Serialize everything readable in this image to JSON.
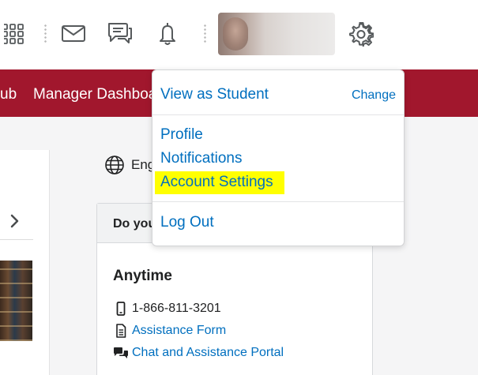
{
  "header": {
    "icons": [
      "apps-grid-icon",
      "mail-icon",
      "chat-icon",
      "bell-icon",
      "gear-icon"
    ]
  },
  "navbar": {
    "links": [
      "ub",
      "Manager Dashboa"
    ]
  },
  "language": {
    "label": "Eng"
  },
  "card": {
    "header_title": "Do you",
    "section_title": "Anytime",
    "phone": "1-866-811-3201",
    "assistance_form": "Assistance Form",
    "chat_portal": "Chat and Assistance Portal"
  },
  "menu": {
    "view_as_student": "View as Student",
    "change": "Change",
    "profile": "Profile",
    "notifications": "Notifications",
    "account_settings": "Account Settings",
    "log_out": "Log Out",
    "highlight_color": "#ffff00"
  },
  "colors": {
    "brand_red": "#a1172d",
    "link_blue": "#006fbf"
  }
}
